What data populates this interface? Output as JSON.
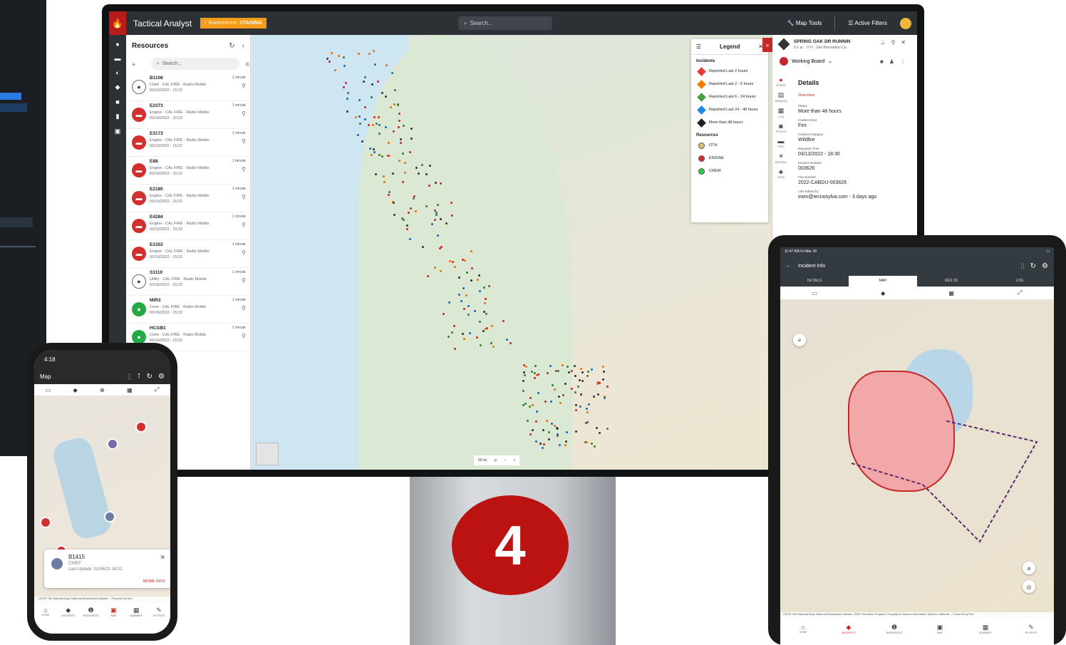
{
  "monitor": {
    "app_title": "Tactical Analyst",
    "env_label": "Environment",
    "env_value": "STAGING",
    "search_placeholder": "Search...",
    "map_tools": "Map Tools",
    "active_filters": "Active Filters",
    "resources": {
      "title": "Resources",
      "search_placeholder": "Search...",
      "items": [
        {
          "id": "B1108",
          "sub": "Chief · CAL FIRE · Radio Mobile",
          "date": "03/16/2022 - 15:22",
          "time": "1 minute",
          "type": "gray"
        },
        {
          "id": "E2373",
          "sub": "Engine · CAL FIRE · Radio Mobile",
          "date": "03/16/2022 - 15:22",
          "time": "1 minute",
          "type": "red"
        },
        {
          "id": "E3173",
          "sub": "Engine · CAL FIRE · Radio Mobile",
          "date": "03/16/2022 - 15:22",
          "time": "1 minute",
          "type": "red"
        },
        {
          "id": "E88",
          "sub": "Engine · CAL FIRE · Radio Mobile",
          "date": "03/16/2022 - 15:22",
          "time": "1 minute",
          "type": "red"
        },
        {
          "id": "E2185",
          "sub": "Engine · CAL FIRE · Radio Mobile",
          "date": "03/16/2022 - 15:22",
          "time": "1 minute",
          "type": "red"
        },
        {
          "id": "E4284",
          "sub": "Engine · CAL FIRE · Radio Mobile",
          "date": "03/16/2022 - 15:22",
          "time": "1 minute",
          "type": "red"
        },
        {
          "id": "E2353",
          "sub": "Engine · CAL FIRE · Radio Mobile",
          "date": "03/16/2022 - 15:22",
          "time": "1 minute",
          "type": "red"
        },
        {
          "id": "S1110",
          "sub": "Utility · CAL FIRE · Radio Mobile",
          "date": "03/16/2022 - 15:22",
          "time": "1 minute",
          "type": "gray"
        },
        {
          "id": "MIR3",
          "sub": "Crew · CAL FIRE · Radio Mobile",
          "date": "03/16/2022 - 15:22",
          "time": "1 minute",
          "type": "green"
        },
        {
          "id": "HCGB1",
          "sub": "Crew · CAL FIRE · Radio Mobile",
          "date": "03/16/2022 - 15:22",
          "time": "1 minute",
          "type": "green"
        }
      ]
    },
    "legend": {
      "title": "Legend",
      "incidents_label": "Incidents",
      "incidents": [
        {
          "label": "Reported Last 2 hours",
          "color": "#e53935"
        },
        {
          "label": "Reported Last 2 - 6 hours",
          "color": "#f57c00"
        },
        {
          "label": "Reported Last 6 - 24 hours",
          "color": "#43a047"
        },
        {
          "label": "Reported Last 24 - 48 hours",
          "color": "#1e88e5"
        },
        {
          "label": "More than 48 hours",
          "color": "#212121"
        }
      ],
      "resources_label": "Resources",
      "resources": [
        {
          "label": "OTH",
          "color": "#d4c36a"
        },
        {
          "label": "ENGINE",
          "color": "#d32f2f"
        },
        {
          "label": "CREW",
          "color": "#2ecc40"
        }
      ]
    },
    "detail": {
      "incident_name": "SPRING OAK DR RUNNIN",
      "incident_sub": "0.1 ac · 0 % · San Bernardino Co.",
      "board": "Working Board",
      "heading": "Details",
      "overview": "Overview",
      "rail": [
        "Details",
        "Mapping",
        "Log",
        "Photos",
        "Files",
        "Weather",
        "Sims"
      ],
      "fields": [
        {
          "label": "Status",
          "value": "More than 48 hours"
        },
        {
          "label": "Incident Kind",
          "value": "Fire"
        },
        {
          "label": "Incident Category",
          "value": "Wildfire"
        },
        {
          "label": "Reported Time",
          "value": "03/13/2022 - 18:30"
        },
        {
          "label": "Incident Number",
          "value": "003626"
        },
        {
          "label": "Fire Number",
          "value": "2022-CABDU-003626"
        },
        {
          "label": "Last Edited by",
          "value": "irwin@tecnosylva.com - 3 days ago"
        }
      ]
    },
    "scale_label": "50 mi"
  },
  "badge": "4",
  "phone": {
    "time": "4:18",
    "title": "Map",
    "card": {
      "id": "B1415",
      "role": "CHIEF",
      "update": "Last Update: 01/06/21 18:22",
      "more": "MORE INFO"
    },
    "credit": "USGS The National Map: National Boundaries Dataset ... Powered by Esri",
    "nav": [
      "HOME",
      "INCIDENTS",
      "RESOURCES",
      "MAP",
      "SUMMARY",
      "MY EDITS"
    ]
  },
  "tablet": {
    "time": "11:47 AM  Fri Mar 18",
    "title": "Incident Info",
    "tabs": [
      "DETAILS",
      "MAP",
      "RES (0)",
      "LOG"
    ],
    "credit": "USGS The National Map: National Boundaries Dataset, 3DEP Elevation Program, Geographic Names Information System, National ... Powered by Esri",
    "nav": [
      "HOME",
      "INCIDENTS",
      "RESOURCES",
      "MAP",
      "SUMMARY",
      "MY EDITS"
    ]
  }
}
